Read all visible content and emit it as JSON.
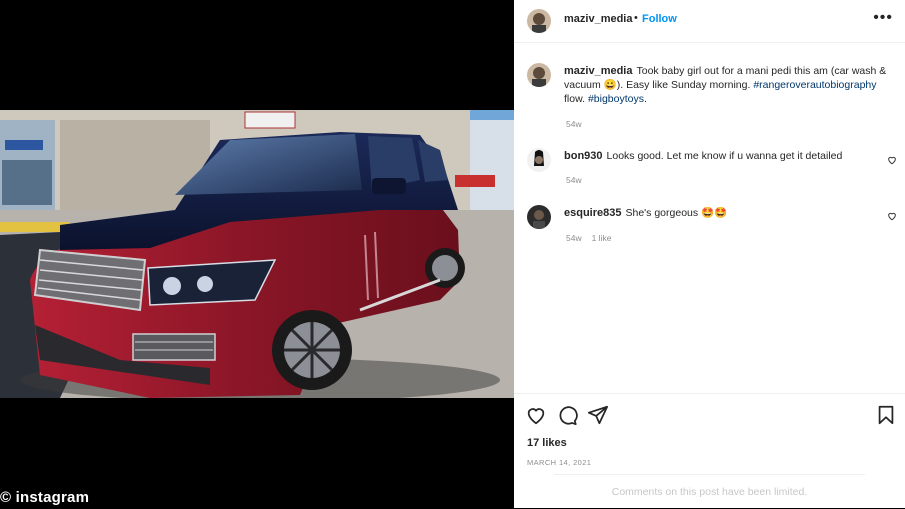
{
  "watermark": "© instagram",
  "post": {
    "author": "maziv_media",
    "separator": "•",
    "follow_label": "Follow",
    "more_label": "•••",
    "caption": {
      "user": "maziv_media",
      "text": "Took baby girl out for a mani pedi this am (car wash & vacuum 😀). Easy like Sunday morning.",
      "hashtag1": "#rangeroverautobiography",
      "mid": " flow. ",
      "hashtag2": "#bigboytoys",
      "end": ".",
      "age": "54w"
    },
    "comments": [
      {
        "user": "bon930",
        "text": "Looks good. Let me know if u wanna get it detailed",
        "age": "54w",
        "likes": ""
      },
      {
        "user": "esquire835",
        "text": "She's gorgeous 🤩🤩",
        "age": "54w",
        "likes": "1 like"
      }
    ],
    "likes": "17 likes",
    "date": "MARCH 14, 2021",
    "comments_limited": "Comments on this post have been limited."
  },
  "icons": {
    "like": "heart-icon",
    "comment": "comment-icon",
    "share": "paper-plane-icon",
    "save": "bookmark-icon",
    "more": "ellipsis-icon"
  },
  "colors": {
    "link": "#0095f6",
    "hashtag": "#00376b",
    "car": "#8a1a2a",
    "roof": "#10183a"
  }
}
